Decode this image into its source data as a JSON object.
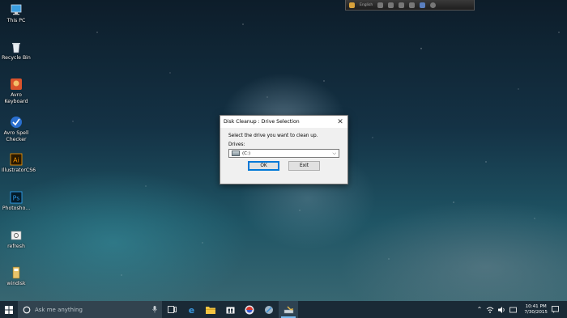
{
  "desktop": {
    "icons": [
      {
        "label": "This PC",
        "icon": "this-pc-icon"
      },
      {
        "label": "Recycle Bin",
        "icon": "recycle-bin-icon"
      },
      {
        "label": "Avro Keyboard",
        "icon": "avro-keyboard-icon"
      },
      {
        "label": "Avro Spell Checker",
        "icon": "avro-spell-checker-icon"
      },
      {
        "label": "IllustratorCS6",
        "icon": "illustrator-icon"
      },
      {
        "label": "Photosho...",
        "icon": "photoshop-icon"
      },
      {
        "label": "refresh",
        "icon": "refresh-icon"
      },
      {
        "label": "windisk",
        "icon": "windisk-icon"
      }
    ]
  },
  "topbar": {
    "language": "English"
  },
  "dialog": {
    "title": "Disk Cleanup : Drive Selection",
    "prompt": "Select the drive you want to clean up.",
    "drives_label": "Drives:",
    "selected_drive": "(C:)",
    "ok_label": "OK",
    "exit_label": "Exit"
  },
  "taskbar": {
    "search_placeholder": "Ask me anything",
    "apps": [
      "task-view-icon",
      "edge-icon",
      "file-explorer-icon",
      "store-icon",
      "browser-icon",
      "app-icon",
      "disk-cleanup-icon"
    ],
    "clock_time": "10:41 PM",
    "clock_date": "7/30/2015"
  },
  "colors": {
    "taskbar": "#1a2a36",
    "accent": "#0078d7"
  }
}
